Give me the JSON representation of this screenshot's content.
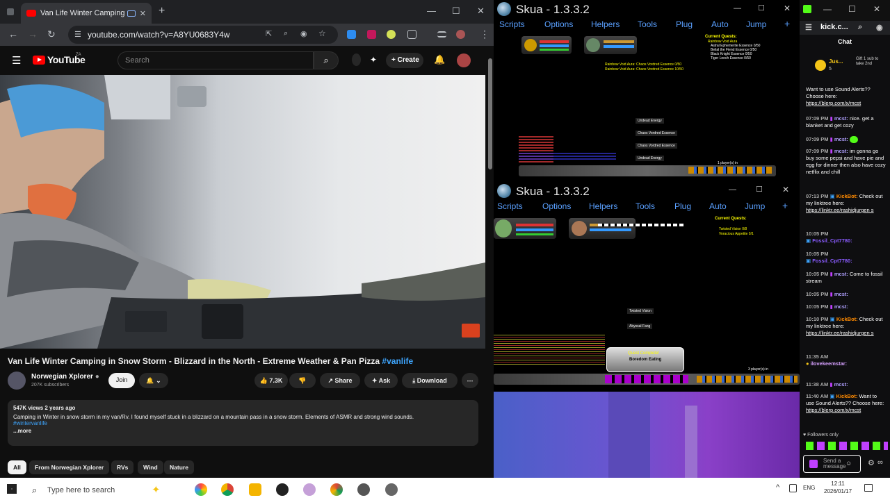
{
  "browser": {
    "tab_title": "Van Life Winter Camping in",
    "url": "youtube.com/watch?v=A8YU0683Y4w"
  },
  "youtube": {
    "logo_text": "YouTube",
    "region": "ZA",
    "search_placeholder": "Search",
    "create_label": "Create",
    "video_title": "Van Life Winter Camping in Snow Storm - Blizzard in the North - Extreme Weather & Pan Pizza",
    "video_hashtag": "#vanlife",
    "channel_name": "Norwegian Xplorer",
    "channel_subs": "207K subscribers",
    "join_label": "Join",
    "like_count": "7.3K",
    "share_label": "Share",
    "ask_label": "Ask",
    "download_label": "Download",
    "views_meta": "547K views  2 years ago",
    "description": "Camping in Winter in snow storm in my van/Rv. I found myself stuck in a blizzard on a mountain pass in a snow storm. Elements of ASMR and strong wind sounds.",
    "desc_hashtag": "#wintervanlife",
    "more_label": "...more",
    "chips": [
      "All",
      "From Norwegian Xplorer",
      "RVs",
      "Wind",
      "Nature"
    ]
  },
  "skua_top": {
    "title": "Skua - 1.3.3.2",
    "menu": [
      "Scripts",
      "Options",
      "Helpers",
      "Tools",
      "Plug",
      "Auto",
      "Jump"
    ],
    "quest_header": "Current Quests:",
    "quest_lines": [
      "Rainbow Void Aura",
      "Astral Ephemerite Essence 0/50",
      "Belial the Fiend Essence 0/50",
      "Black Knight Essence 0/50",
      "Tiger Leech Essence 0/50"
    ],
    "aura_lines": [
      "Rainbow Void Aura: Chaos Vordred Essence 0/50",
      "Rainbow Void Aura: Chaos Vordred Essence 10/50"
    ],
    "pickups": [
      "Undead Energy",
      "Chaos Vordred Essence",
      "Chaos Vordred Essence",
      "Undead Energy"
    ],
    "players_note": "1 player(s) in"
  },
  "skua_bottom": {
    "title": "Skua - 1.3.3.2",
    "menu": [
      "Scripts",
      "Options",
      "Helpers",
      "Tools",
      "Plug",
      "Auto",
      "Jump"
    ],
    "quest_header": "Current Quests:",
    "quest_lines": [
      "Twisted Vision 0/8",
      "Voracious Appetite 0/1"
    ],
    "pickups": [
      "Twisted Vision",
      "Abyssal Fang"
    ],
    "complete_title": "Quest Complete!",
    "complete_name": "Boredom Eating",
    "players_note": "3 player(s) in"
  },
  "kick": {
    "tab_title": "kick.c...",
    "chat_label": "Chat",
    "gift_user": "Jus...",
    "gift_count": "5",
    "gift_text": "Gift 1 sub to take 2nd",
    "messages": [
      {
        "time": "",
        "user": "",
        "text": "Want to use Sound Alerts?? Choose here:",
        "link": "https://blerp.com/x/mcst"
      },
      {
        "time": "07:09 PM",
        "user": "mcst:",
        "text": "nice. get a blanket and get cozy",
        "link": ""
      },
      {
        "time": "07:09 PM",
        "user": "mcst:",
        "text": "",
        "link": ""
      },
      {
        "time": "07:09 PM",
        "user": "mcst:",
        "text": "im gonna go buy some pepsi and have pie and egg for dinner then also have cozy netflix and chill",
        "link": ""
      },
      {
        "time": "07:13 PM",
        "user": "KickBot:",
        "text": "Check out my linktree here:",
        "link": "https://linktr.ee/rashidjurgen s"
      },
      {
        "time": "10:05 PM",
        "user": "Fossil_Cpt7780:",
        "text": "",
        "link": ""
      },
      {
        "time": "10:05 PM",
        "user": "Fossil_Cpt7780:",
        "text": "",
        "link": ""
      },
      {
        "time": "10:05 PM",
        "user": "mcst:",
        "text": "Come to fossil stream",
        "link": ""
      },
      {
        "time": "10:05 PM",
        "user": "mcst:",
        "text": "",
        "link": ""
      },
      {
        "time": "10:05 PM",
        "user": "mcst:",
        "text": "",
        "link": ""
      },
      {
        "time": "10:10 PM",
        "user": "KickBot:",
        "text": "Check out my linktree here:",
        "link": "https://linktr.ee/rashidjurgen s"
      },
      {
        "time": "11:35 AM",
        "user": "ilovekeemstar:",
        "text": "",
        "link": ""
      },
      {
        "time": "11:38 AM",
        "user": "mcst:",
        "text": "",
        "link": ""
      },
      {
        "time": "11:40 AM",
        "user": "KickBot:",
        "text": "Want to use Sound Alerts?? Choose here:",
        "link": "https://blerp.com/x/mcst"
      }
    ],
    "followers_only": "Followers only",
    "send_placeholder": "Send a message"
  },
  "taskbar": {
    "search_placeholder": "Type here to search",
    "lang": "ENG",
    "time": "12:11",
    "date": "2026/01/17"
  },
  "colors": {
    "skua_menu": "#5aa0ff",
    "youtube_red": "#ff0000",
    "kick_green": "#53fc18",
    "link_blue": "#3ea6ff"
  }
}
